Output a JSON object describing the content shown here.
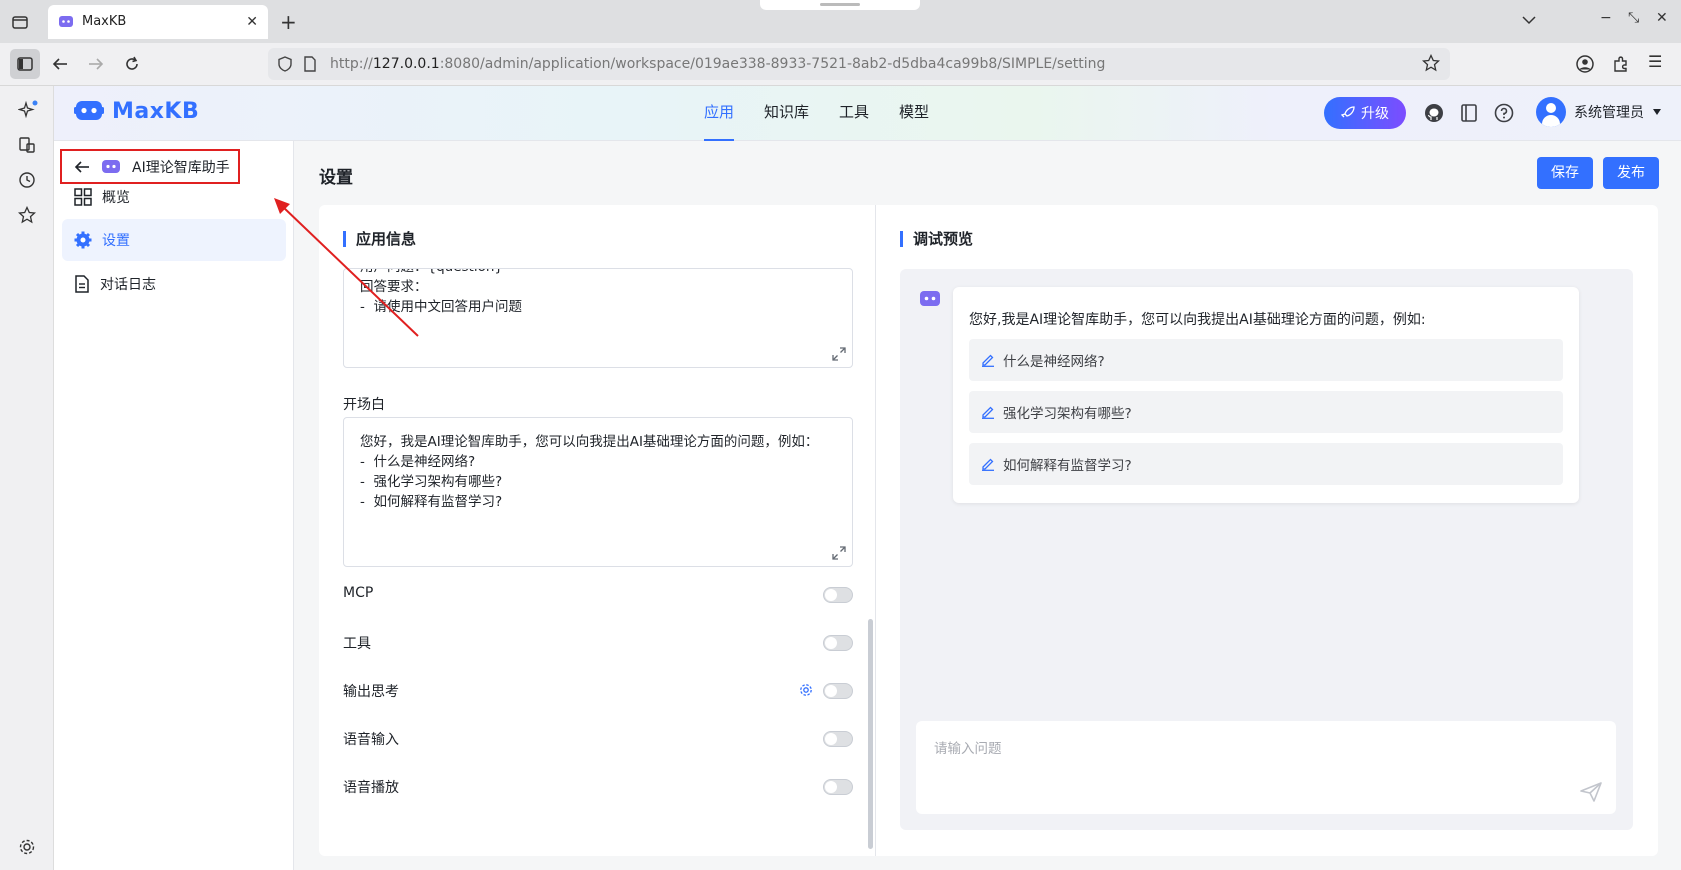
{
  "browser": {
    "tab_title": "MaxKB",
    "url_prefix": "http://",
    "url_host": "127.0.0.1",
    "url_rest": ":8080/admin/application/workspace/019ae338-8933-7521-8ab2-d5dba4ca99b8/SIMPLE/setting"
  },
  "header": {
    "logo_text": "MaxKB",
    "nav": [
      {
        "label": "应用",
        "active": true
      },
      {
        "label": "知识库",
        "active": false
      },
      {
        "label": "工具",
        "active": false
      },
      {
        "label": "模型",
        "active": false
      }
    ],
    "upgrade_label": "升级",
    "user_name": "系统管理员"
  },
  "sidebar": {
    "app_name": "AI理论智库助手",
    "items": [
      {
        "label": "概览",
        "icon": "grid-icon",
        "active": false
      },
      {
        "label": "设置",
        "icon": "gear-icon",
        "active": true
      },
      {
        "label": "对话日志",
        "icon": "document-icon",
        "active": false
      }
    ]
  },
  "main": {
    "title": "设置",
    "save_label": "保存",
    "publish_label": "发布",
    "app_info": {
      "section_title": "应用信息",
      "prompt_lines": [
        "用户问题：{question}",
        "回答要求：",
        "-  请使用中文回答用户问题"
      ],
      "opening_label": "开场白",
      "opening_lines": [
        "您好，我是AI理论智库助手，您可以向我提出AI基础理论方面的问题，例如：",
        "-  什么是神经网络?",
        "-  强化学习架构有哪些?",
        "-  如何解释有监督学习?"
      ],
      "toggles": [
        {
          "label": "MCP",
          "on": false,
          "has_gear": false
        },
        {
          "label": "工具",
          "on": false,
          "has_gear": false
        },
        {
          "label": "输出思考",
          "on": false,
          "has_gear": true
        },
        {
          "label": "语音输入",
          "on": false,
          "has_gear": false
        },
        {
          "label": "语音播放",
          "on": false,
          "has_gear": false
        }
      ]
    },
    "preview": {
      "section_title": "调试预览",
      "greeting": "您好,我是AI理论智库助手，您可以向我提出AI基础理论方面的问题，例如:",
      "suggestions": [
        "什么是神经网络?",
        "强化学习架构有哪些?",
        "如何解释有监督学习?"
      ],
      "input_placeholder": "请输入问题"
    }
  },
  "colors": {
    "accent": "#3370ff",
    "annotation": "#e02020"
  }
}
